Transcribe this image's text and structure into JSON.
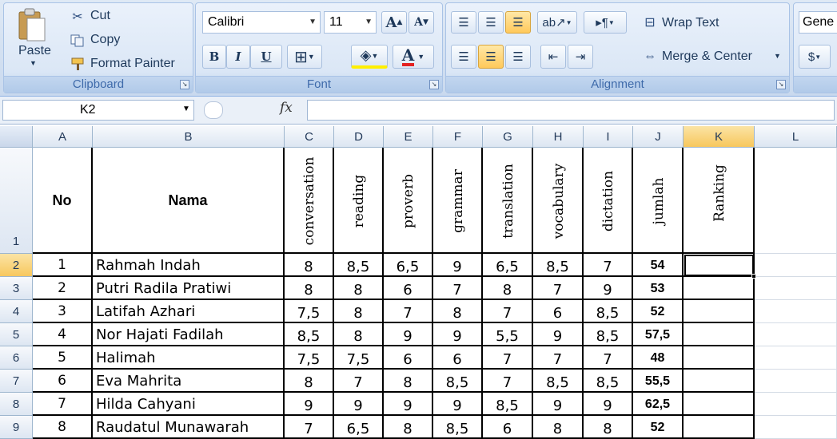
{
  "clipboard": {
    "paste_label": "Paste",
    "cut_label": "Cut",
    "copy_label": "Copy",
    "format_painter_label": "Format Painter",
    "group_label": "Clipboard"
  },
  "font": {
    "name": "Calibri",
    "size": "11",
    "group_label": "Font",
    "bold": "B",
    "italic": "I",
    "underline": "U",
    "grow": "A",
    "shrink": "A"
  },
  "alignment": {
    "wrap_text_label": "Wrap Text",
    "merge_center_label": "Merge & Center",
    "group_label": "Alignment"
  },
  "number": {
    "format_label": "Gene"
  },
  "formula_bar": {
    "name_box": "K2",
    "fx": "fx",
    "formula": ""
  },
  "columns": [
    "A",
    "B",
    "C",
    "D",
    "E",
    "F",
    "G",
    "H",
    "I",
    "J",
    "K",
    "L"
  ],
  "row_numbers": [
    "1",
    "2",
    "3",
    "4",
    "5",
    "6",
    "7",
    "8",
    "9"
  ],
  "selected_cell": "K2",
  "headers": {
    "no": "No",
    "nama": "Nama",
    "subjects": [
      "conversation",
      "reading",
      "proverb",
      "grammar",
      "translation",
      "vocabulary",
      "dictation",
      "jumlah",
      "Ranking"
    ]
  },
  "rows": [
    {
      "no": "1",
      "nama": "Rahmah Indah",
      "scores": [
        "8",
        "8,5",
        "6,5",
        "9",
        "6,5",
        "8,5",
        "7",
        "54"
      ]
    },
    {
      "no": "2",
      "nama": "Putri Radila Pratiwi",
      "scores": [
        "8",
        "8",
        "6",
        "7",
        "8",
        "7",
        "9",
        "53"
      ]
    },
    {
      "no": "3",
      "nama": "Latifah Azhari",
      "scores": [
        "7,5",
        "8",
        "7",
        "8",
        "7",
        "6",
        "8,5",
        "52"
      ]
    },
    {
      "no": "4",
      "nama": "Nor Hajati Fadilah",
      "scores": [
        "8,5",
        "8",
        "9",
        "9",
        "5,5",
        "9",
        "8,5",
        "57,5"
      ]
    },
    {
      "no": "5",
      "nama": "Halimah",
      "scores": [
        "7,5",
        "7,5",
        "6",
        "6",
        "7",
        "7",
        "7",
        "48"
      ]
    },
    {
      "no": "6",
      "nama": "Eva Mahrita",
      "scores": [
        "8",
        "7",
        "8",
        "8,5",
        "7",
        "8,5",
        "8,5",
        "55,5"
      ]
    },
    {
      "no": "7",
      "nama": "Hilda Cahyani",
      "scores": [
        "9",
        "9",
        "9",
        "9",
        "8,5",
        "9",
        "9",
        "62,5"
      ]
    },
    {
      "no": "8",
      "nama": "Raudatul Munawarah",
      "scores": [
        "7",
        "6,5",
        "8",
        "8,5",
        "6",
        "8",
        "8",
        "52"
      ]
    }
  ]
}
